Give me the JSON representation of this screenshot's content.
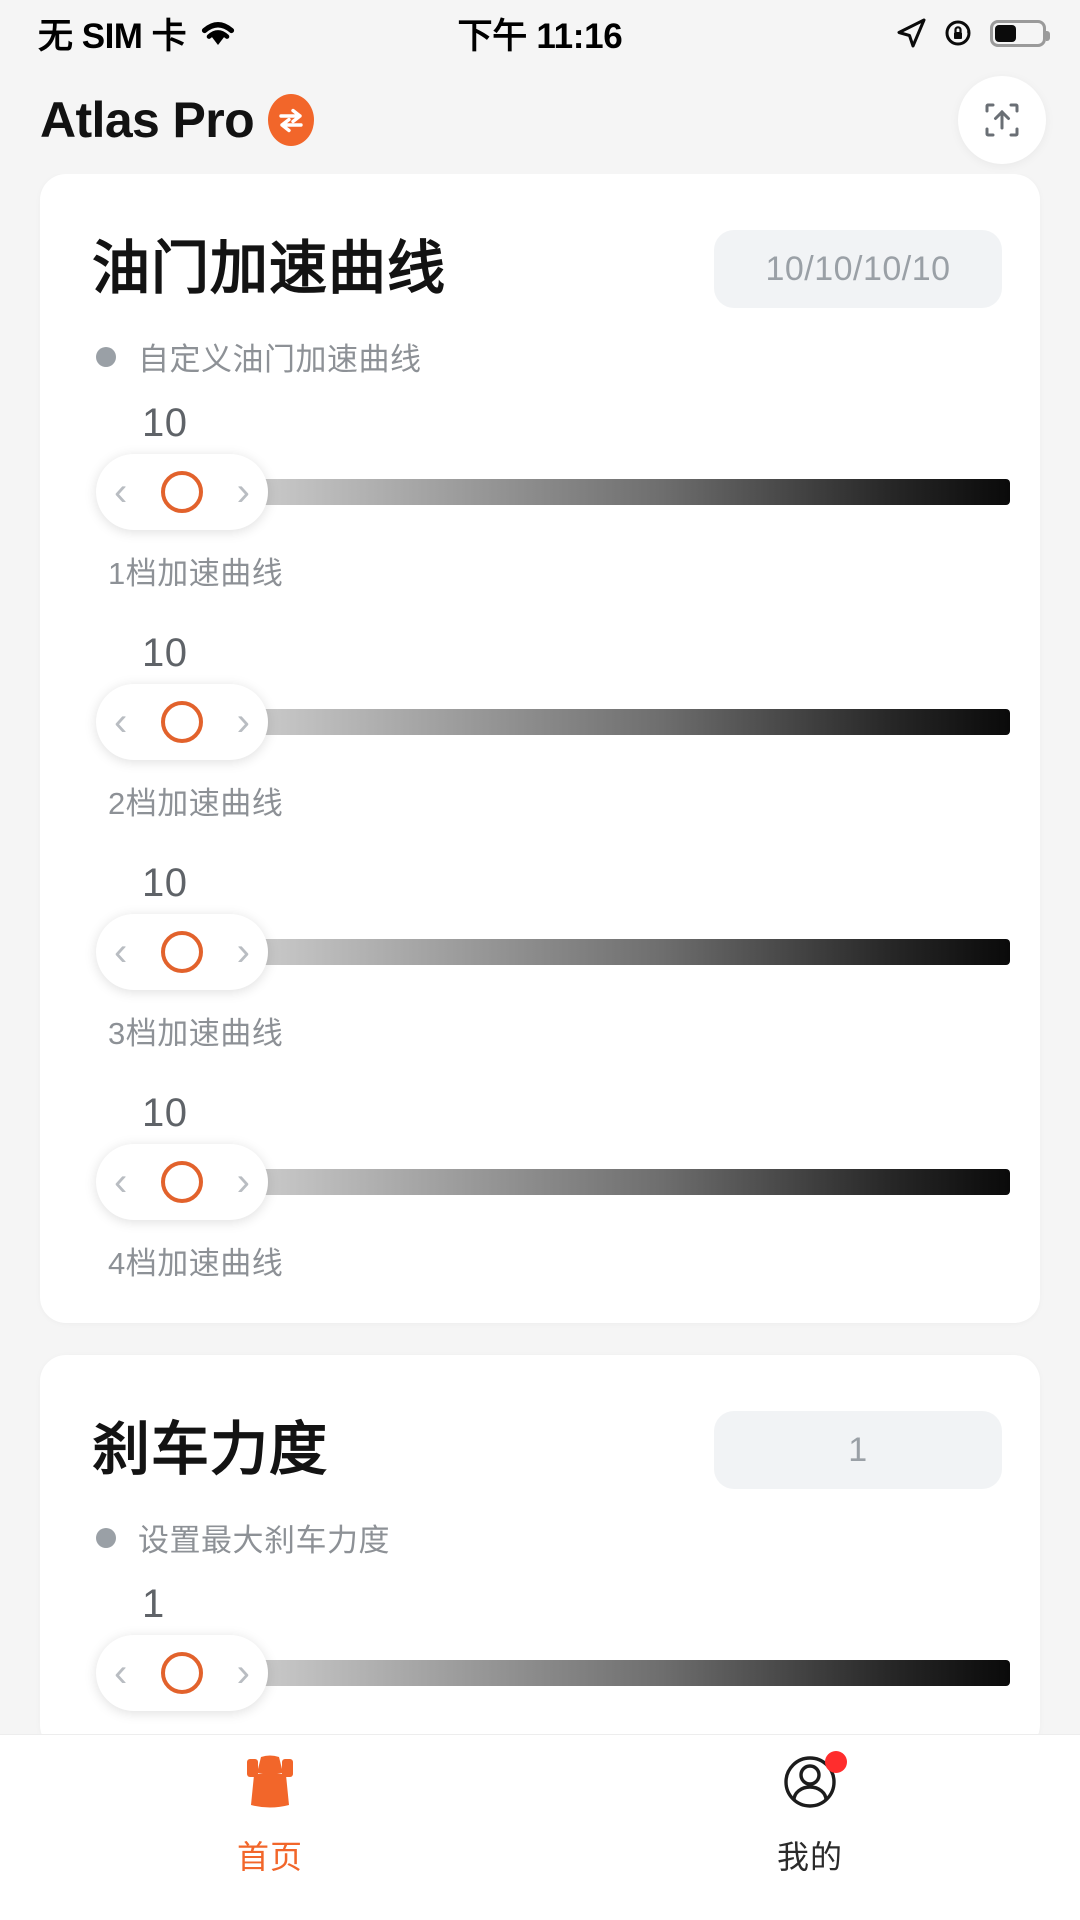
{
  "status_bar": {
    "carrier": "无 SIM 卡",
    "wifi_icon": "wifi-icon",
    "time": "下午 11:16",
    "location_icon": "location-arrow-icon",
    "rotation_lock_icon": "rotation-lock-icon",
    "battery_icon": "battery-icon",
    "battery_level_pct": 45
  },
  "app_bar": {
    "title": "Atlas Pro",
    "brand_badge_icon": "swap-arrows-icon",
    "brand_color": "#f2662a",
    "upload_button_icon": "upload-box-icon"
  },
  "cards": [
    {
      "title": "油门加速曲线",
      "badge": "10/10/10/10",
      "subtitle": "自定义油门加速曲线",
      "rows": [
        {
          "value": "10",
          "label": "1档加速曲线",
          "fill_pct": 100
        },
        {
          "value": "10",
          "label": "2档加速曲线",
          "fill_pct": 100
        },
        {
          "value": "10",
          "label": "3档加速曲线",
          "fill_pct": 100
        },
        {
          "value": "10",
          "label": "4档加速曲线",
          "fill_pct": 100
        }
      ]
    },
    {
      "title": "刹车力度",
      "badge": "1",
      "subtitle": "设置最大刹车力度",
      "rows": [
        {
          "value": "1",
          "label": "",
          "fill_pct": 100
        }
      ]
    }
  ],
  "tab_bar": {
    "tabs": [
      {
        "label": "首页",
        "icon": "car-front-icon",
        "active": true,
        "badge": false
      },
      {
        "label": "我的",
        "icon": "user-profile-icon",
        "active": false,
        "badge": true
      }
    ],
    "active_color": "#f2662a",
    "badge_color": "#ff2d2d"
  }
}
